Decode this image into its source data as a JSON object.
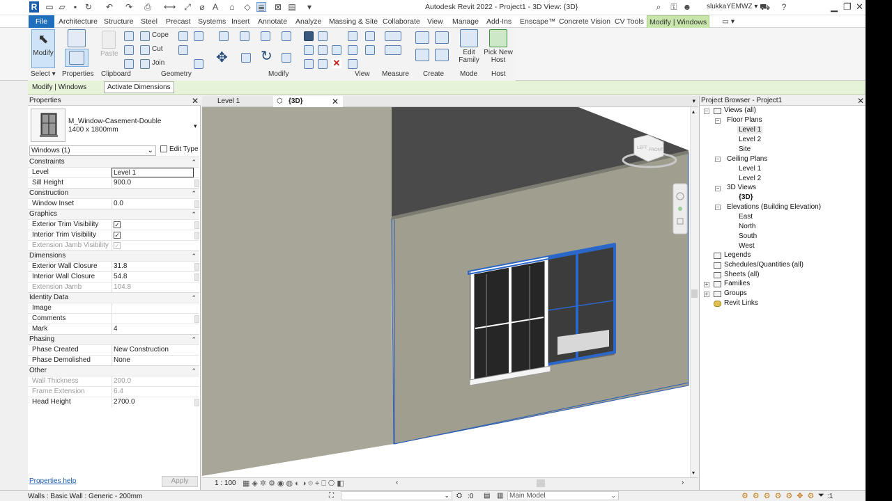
{
  "app": {
    "title": "Autodesk Revit 2022 - Project1 - 3D View: {3D}",
    "user": "slukkaYEMWZ",
    "logo": "R"
  },
  "tabs": [
    "File",
    "Architecture",
    "Structure",
    "Steel",
    "Precast",
    "Systems",
    "Insert",
    "Annotate",
    "Analyze",
    "Massing & Site",
    "Collaborate",
    "View",
    "Manage",
    "Add-Ins",
    "Enscape™",
    "Concrete Vision",
    "CV Tools",
    "Modify | Windows"
  ],
  "ribbon": {
    "modify_label": "Modify",
    "properties_label": "Properties",
    "paste_label": "Paste",
    "cope_label": "Cope",
    "cut_label": "Cut",
    "join_label": "Join",
    "edit_family_label": "Edit Family",
    "pick_new_host_label": "Pick New Host",
    "panels": [
      "Select ▾",
      "Properties",
      "Clipboard",
      "Geometry",
      "Modify",
      "View",
      "Measure",
      "Create",
      "Mode",
      "Host"
    ]
  },
  "options_bar": {
    "context": "Modify | Windows",
    "activate_dimensions": "Activate Dimensions"
  },
  "properties": {
    "header": "Properties",
    "type_name": "M_Window-Casement-Double",
    "type_size": "1400 x 1800mm",
    "instance_filter": "Windows (1)",
    "edit_type": "Edit Type",
    "groups": [
      {
        "name": "Constraints",
        "rows": [
          {
            "k": "Level",
            "v": "Level 1"
          },
          {
            "k": "Sill Height",
            "v": "900.0"
          }
        ]
      },
      {
        "name": "Construction",
        "rows": [
          {
            "k": "Window Inset",
            "v": "0.0"
          }
        ]
      },
      {
        "name": "Graphics",
        "rows": [
          {
            "k": "Exterior Trim Visibility",
            "v": "✓"
          },
          {
            "k": "Interior Trim Visibility",
            "v": "✓"
          },
          {
            "k": "Extension Jamb Visibility",
            "v": "✓"
          }
        ]
      },
      {
        "name": "Dimensions",
        "rows": [
          {
            "k": "Exterior Wall Closure",
            "v": "31.8"
          },
          {
            "k": "Interior Wall Closure",
            "v": "54.8"
          },
          {
            "k": "Extension Jamb",
            "v": "104.8"
          }
        ]
      },
      {
        "name": "Identity Data",
        "rows": [
          {
            "k": "Image",
            "v": ""
          },
          {
            "k": "Comments",
            "v": ""
          },
          {
            "k": "Mark",
            "v": "4"
          }
        ]
      },
      {
        "name": "Phasing",
        "rows": [
          {
            "k": "Phase Created",
            "v": "New Construction"
          },
          {
            "k": "Phase Demolished",
            "v": "None"
          }
        ]
      },
      {
        "name": "Other",
        "rows": [
          {
            "k": "Wall Thickness",
            "v": "200.0"
          },
          {
            "k": "Frame Extension",
            "v": "6.4"
          },
          {
            "k": "Head Height",
            "v": "2700.0"
          }
        ]
      }
    ],
    "help_link": "Properties help",
    "apply": "Apply"
  },
  "view_tabs": [
    {
      "label": "Level 1"
    },
    {
      "label": "{3D}"
    }
  ],
  "view": {
    "scale": "1 : 100",
    "viewcube_labels": [
      "LEFT",
      "FRONT"
    ]
  },
  "browser": {
    "header": "Project Browser - Project1",
    "nodes": [
      "Views (all)",
      "Floor Plans",
      "Level 1",
      "Level 2",
      "Site",
      "Ceiling Plans",
      "Level 1",
      "Level 2",
      "3D Views",
      "{3D}",
      "Elevations (Building Elevation)",
      "East",
      "North",
      "South",
      "West",
      "Legends",
      "Schedules/Quantities (all)",
      "Sheets (all)",
      "Families",
      "Groups",
      "Revit Links"
    ]
  },
  "status": {
    "text": "Walls : Basic Wall : Generic - 200mm",
    "workset_zero": ":0",
    "model": "Main Model",
    "filter_count": ":1"
  },
  "colors": {
    "accent": "#1f6fbd",
    "context_tab": "#c8e6ab",
    "options_bar": "#e6f3d9",
    "selection_blue": "#2b67c9"
  }
}
